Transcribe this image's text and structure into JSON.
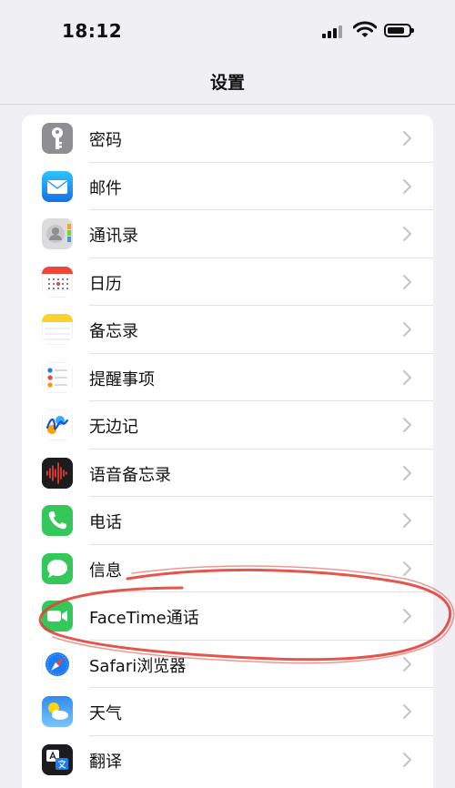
{
  "status_bar": {
    "time": "18:12"
  },
  "nav": {
    "title": "设置"
  },
  "rows": [
    {
      "label": "密码",
      "icon": "key-icon"
    },
    {
      "label": "邮件",
      "icon": "mail-icon"
    },
    {
      "label": "通讯录",
      "icon": "contacts-icon"
    },
    {
      "label": "日历",
      "icon": "calendar-icon"
    },
    {
      "label": "备忘录",
      "icon": "notes-icon"
    },
    {
      "label": "提醒事项",
      "icon": "reminders-icon"
    },
    {
      "label": "无边记",
      "icon": "freeform-icon"
    },
    {
      "label": "语音备忘录",
      "icon": "voice-memos-icon"
    },
    {
      "label": "电话",
      "icon": "phone-icon"
    },
    {
      "label": "信息",
      "icon": "messages-icon"
    },
    {
      "label": "FaceTime通话",
      "icon": "facetime-icon"
    },
    {
      "label": "Safari浏览器",
      "icon": "safari-icon"
    },
    {
      "label": "天气",
      "icon": "weather-icon"
    },
    {
      "label": "翻译",
      "icon": "translate-icon"
    }
  ],
  "colors": {
    "annotation_stroke": "#e0443a",
    "accent_blue": "#1c7cf3",
    "green": "#34c759"
  }
}
